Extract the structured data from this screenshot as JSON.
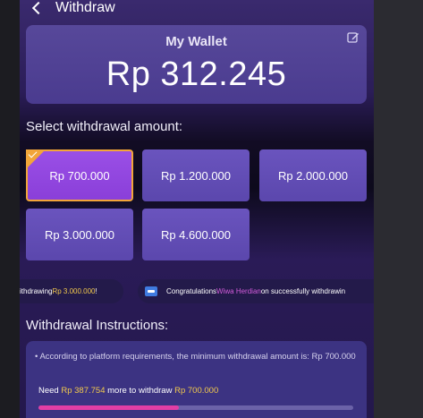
{
  "header": {
    "title": "Withdraw"
  },
  "wallet": {
    "title": "My Wallet",
    "amount": "Rp 312.245"
  },
  "select_label": "Select withdrawal amount:",
  "amounts": [
    {
      "label": "Rp 700.000",
      "selected": true
    },
    {
      "label": "Rp 1.200.000",
      "selected": false
    },
    {
      "label": "Rp 2.000.000",
      "selected": false
    },
    {
      "label": "Rp 3.000.000",
      "selected": false
    },
    {
      "label": "Rp 4.600.000",
      "selected": false
    }
  ],
  "ticker": {
    "item1": {
      "prefix": "ithdrawing ",
      "amount": "Rp 3.000.000",
      "suffix": "!"
    },
    "item2": {
      "prefix": "Congratulations ",
      "name": "Wiwa Herdian",
      "suffix": " on successfully withdrawin"
    }
  },
  "instructions": {
    "label": "Withdrawal Instructions:",
    "rule": "• According to platform requirements, the minimum withdrawal amount is: Rp 700.000",
    "need_prefix": "Need ",
    "need_amount": "Rp 387.754",
    "need_middle": " more to withdraw ",
    "need_target": "Rp 700.000",
    "progress_fraction": 0.446
  },
  "colors": {
    "accent": "#f2a53a",
    "progress": "#e23ea5",
    "highlight": "#f2c94c"
  }
}
